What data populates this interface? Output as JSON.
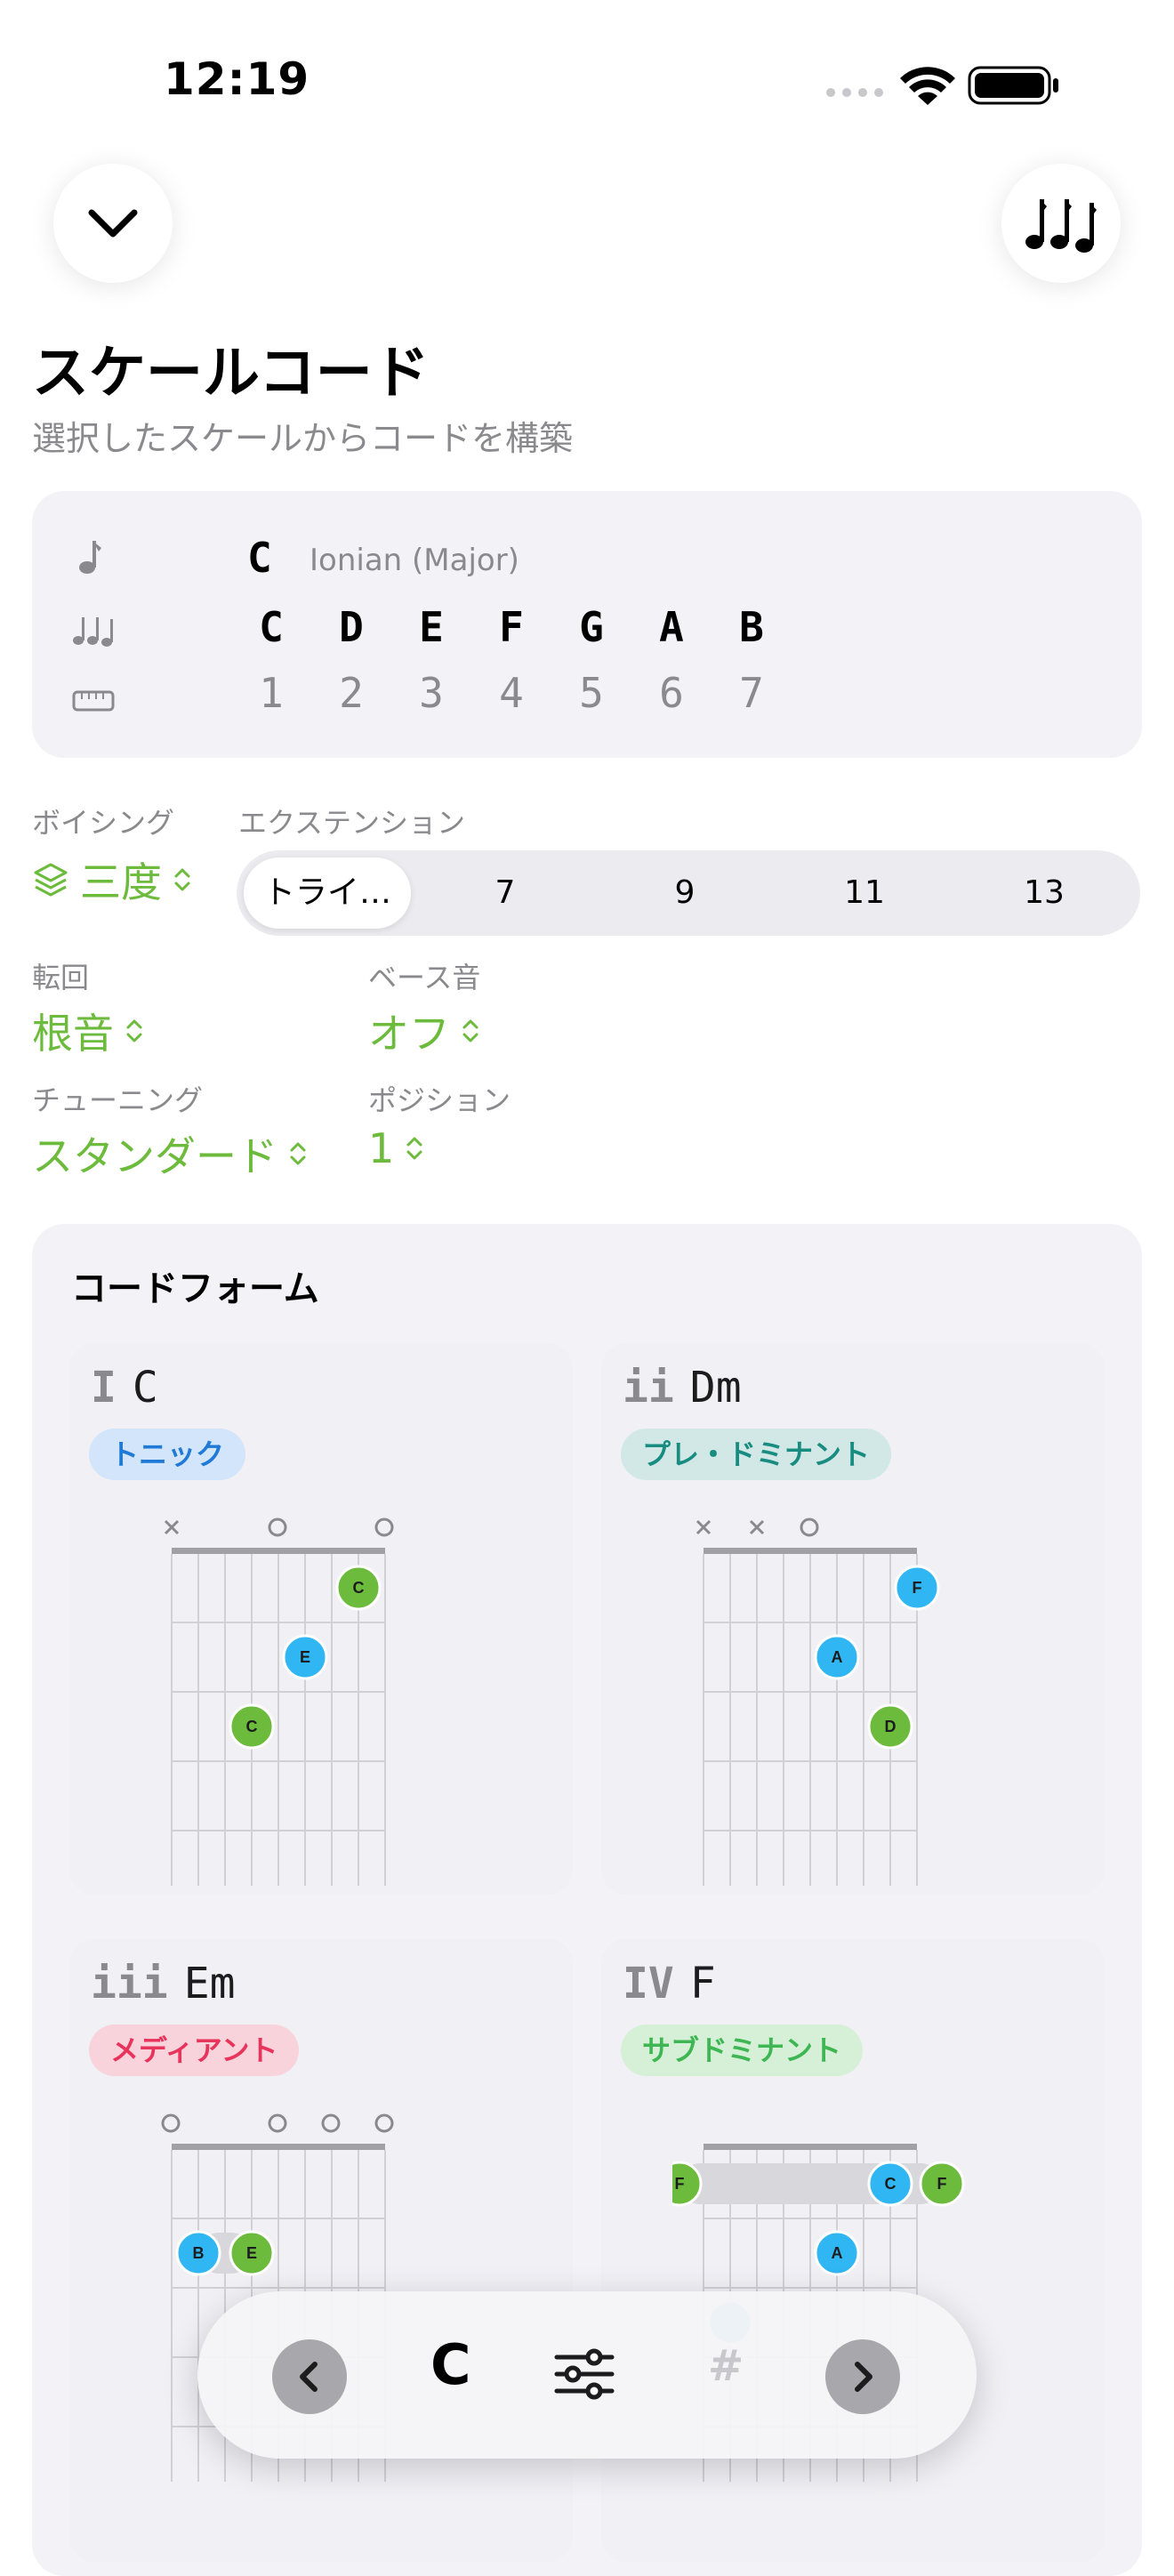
{
  "status_bar": {
    "time": "12:19"
  },
  "header": {
    "title": "スケールコード",
    "subtitle": "選択したスケールからコードを構築"
  },
  "scale": {
    "root": "C",
    "mode": "Ionian (Major)",
    "notes": [
      "C",
      "D",
      "E",
      "F",
      "G",
      "A",
      "B"
    ],
    "degrees": [
      "1",
      "2",
      "3",
      "4",
      "5",
      "6",
      "7"
    ]
  },
  "controls": {
    "voicing": {
      "label": "ボイシング",
      "value": "三度"
    },
    "extension": {
      "label": "エクステンション",
      "options": [
        "トライ…",
        "7",
        "9",
        "11",
        "13"
      ],
      "selected": "トライ…"
    },
    "inversion": {
      "label": "転回",
      "value": "根音"
    },
    "bass": {
      "label": "ベース音",
      "value": "オフ"
    },
    "tuning": {
      "label": "チューニング",
      "value": "スタンダード"
    },
    "position": {
      "label": "ポジション",
      "value": "1"
    }
  },
  "chord_forms": {
    "title": "コードフォーム",
    "chords": [
      {
        "numeral": "I",
        "name": "C",
        "function": "トニック"
      },
      {
        "numeral": "ii",
        "name": "Dm",
        "function": "プレ・ドミナント"
      },
      {
        "numeral": "iii",
        "name": "Em",
        "function": "メディアント"
      },
      {
        "numeral": "IV",
        "name": "F",
        "function": "サブドミナント"
      }
    ]
  },
  "bottom_bar": {
    "key": "C",
    "sharp": "#"
  },
  "colors": {
    "accent": "#6cbb3c",
    "tonic_badge_bg": "#d3e5fb",
    "tonic_badge_fg": "#1e7ad6",
    "predominant_badge_bg": "#d1e8e6",
    "predominant_badge_fg": "#188c80",
    "mediant_badge_bg": "#f8d3db",
    "mediant_badge_fg": "#e8335a",
    "subdominant_badge_bg": "#d6f0d7",
    "subdominant_badge_fg": "#3fb654",
    "root_dot": "#6cbb3c",
    "tone_dot": "#30b6f2"
  },
  "icons": [
    "chevron-down-icon",
    "notes-icon",
    "note-icon",
    "ruler-icon",
    "layers-icon",
    "chevron-left-icon",
    "sliders-icon",
    "chevron-right-icon",
    "wifi-icon",
    "battery-icon"
  ]
}
